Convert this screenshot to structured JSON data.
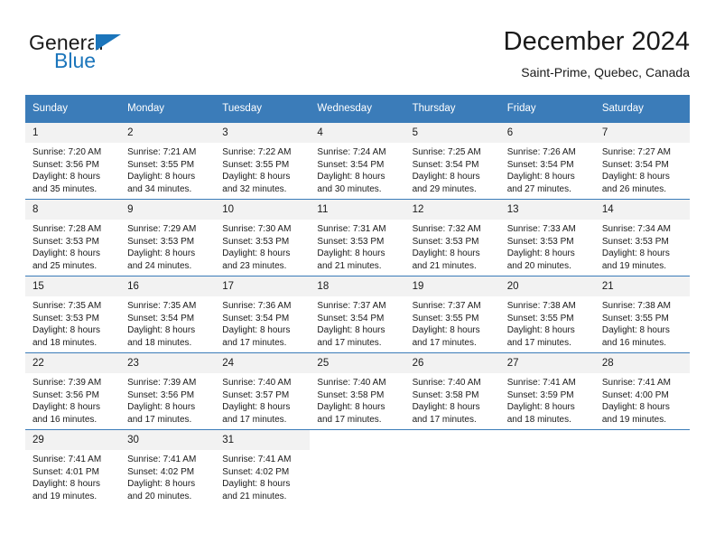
{
  "brand": {
    "word_one": "General",
    "word_two": "Blue",
    "accent_color": "#1b75bb",
    "logo_icon": "triangle-logo-icon"
  },
  "header": {
    "title": "December 2024",
    "subtitle": "Saint-Prime, Quebec, Canada"
  },
  "calendar": {
    "header_bg": "#3b7cb9",
    "daynum_bg": "#f2f2f2",
    "weekdays": [
      "Sunday",
      "Monday",
      "Tuesday",
      "Wednesday",
      "Thursday",
      "Friday",
      "Saturday"
    ],
    "weeks": [
      [
        {
          "day": "1",
          "sunrise": "Sunrise: 7:20 AM",
          "sunset": "Sunset: 3:56 PM",
          "daylight_line1": "Daylight: 8 hours",
          "daylight_line2": "and 35 minutes."
        },
        {
          "day": "2",
          "sunrise": "Sunrise: 7:21 AM",
          "sunset": "Sunset: 3:55 PM",
          "daylight_line1": "Daylight: 8 hours",
          "daylight_line2": "and 34 minutes."
        },
        {
          "day": "3",
          "sunrise": "Sunrise: 7:22 AM",
          "sunset": "Sunset: 3:55 PM",
          "daylight_line1": "Daylight: 8 hours",
          "daylight_line2": "and 32 minutes."
        },
        {
          "day": "4",
          "sunrise": "Sunrise: 7:24 AM",
          "sunset": "Sunset: 3:54 PM",
          "daylight_line1": "Daylight: 8 hours",
          "daylight_line2": "and 30 minutes."
        },
        {
          "day": "5",
          "sunrise": "Sunrise: 7:25 AM",
          "sunset": "Sunset: 3:54 PM",
          "daylight_line1": "Daylight: 8 hours",
          "daylight_line2": "and 29 minutes."
        },
        {
          "day": "6",
          "sunrise": "Sunrise: 7:26 AM",
          "sunset": "Sunset: 3:54 PM",
          "daylight_line1": "Daylight: 8 hours",
          "daylight_line2": "and 27 minutes."
        },
        {
          "day": "7",
          "sunrise": "Sunrise: 7:27 AM",
          "sunset": "Sunset: 3:54 PM",
          "daylight_line1": "Daylight: 8 hours",
          "daylight_line2": "and 26 minutes."
        }
      ],
      [
        {
          "day": "8",
          "sunrise": "Sunrise: 7:28 AM",
          "sunset": "Sunset: 3:53 PM",
          "daylight_line1": "Daylight: 8 hours",
          "daylight_line2": "and 25 minutes."
        },
        {
          "day": "9",
          "sunrise": "Sunrise: 7:29 AM",
          "sunset": "Sunset: 3:53 PM",
          "daylight_line1": "Daylight: 8 hours",
          "daylight_line2": "and 24 minutes."
        },
        {
          "day": "10",
          "sunrise": "Sunrise: 7:30 AM",
          "sunset": "Sunset: 3:53 PM",
          "daylight_line1": "Daylight: 8 hours",
          "daylight_line2": "and 23 minutes."
        },
        {
          "day": "11",
          "sunrise": "Sunrise: 7:31 AM",
          "sunset": "Sunset: 3:53 PM",
          "daylight_line1": "Daylight: 8 hours",
          "daylight_line2": "and 21 minutes."
        },
        {
          "day": "12",
          "sunrise": "Sunrise: 7:32 AM",
          "sunset": "Sunset: 3:53 PM",
          "daylight_line1": "Daylight: 8 hours",
          "daylight_line2": "and 21 minutes."
        },
        {
          "day": "13",
          "sunrise": "Sunrise: 7:33 AM",
          "sunset": "Sunset: 3:53 PM",
          "daylight_line1": "Daylight: 8 hours",
          "daylight_line2": "and 20 minutes."
        },
        {
          "day": "14",
          "sunrise": "Sunrise: 7:34 AM",
          "sunset": "Sunset: 3:53 PM",
          "daylight_line1": "Daylight: 8 hours",
          "daylight_line2": "and 19 minutes."
        }
      ],
      [
        {
          "day": "15",
          "sunrise": "Sunrise: 7:35 AM",
          "sunset": "Sunset: 3:53 PM",
          "daylight_line1": "Daylight: 8 hours",
          "daylight_line2": "and 18 minutes."
        },
        {
          "day": "16",
          "sunrise": "Sunrise: 7:35 AM",
          "sunset": "Sunset: 3:54 PM",
          "daylight_line1": "Daylight: 8 hours",
          "daylight_line2": "and 18 minutes."
        },
        {
          "day": "17",
          "sunrise": "Sunrise: 7:36 AM",
          "sunset": "Sunset: 3:54 PM",
          "daylight_line1": "Daylight: 8 hours",
          "daylight_line2": "and 17 minutes."
        },
        {
          "day": "18",
          "sunrise": "Sunrise: 7:37 AM",
          "sunset": "Sunset: 3:54 PM",
          "daylight_line1": "Daylight: 8 hours",
          "daylight_line2": "and 17 minutes."
        },
        {
          "day": "19",
          "sunrise": "Sunrise: 7:37 AM",
          "sunset": "Sunset: 3:55 PM",
          "daylight_line1": "Daylight: 8 hours",
          "daylight_line2": "and 17 minutes."
        },
        {
          "day": "20",
          "sunrise": "Sunrise: 7:38 AM",
          "sunset": "Sunset: 3:55 PM",
          "daylight_line1": "Daylight: 8 hours",
          "daylight_line2": "and 17 minutes."
        },
        {
          "day": "21",
          "sunrise": "Sunrise: 7:38 AM",
          "sunset": "Sunset: 3:55 PM",
          "daylight_line1": "Daylight: 8 hours",
          "daylight_line2": "and 16 minutes."
        }
      ],
      [
        {
          "day": "22",
          "sunrise": "Sunrise: 7:39 AM",
          "sunset": "Sunset: 3:56 PM",
          "daylight_line1": "Daylight: 8 hours",
          "daylight_line2": "and 16 minutes."
        },
        {
          "day": "23",
          "sunrise": "Sunrise: 7:39 AM",
          "sunset": "Sunset: 3:56 PM",
          "daylight_line1": "Daylight: 8 hours",
          "daylight_line2": "and 17 minutes."
        },
        {
          "day": "24",
          "sunrise": "Sunrise: 7:40 AM",
          "sunset": "Sunset: 3:57 PM",
          "daylight_line1": "Daylight: 8 hours",
          "daylight_line2": "and 17 minutes."
        },
        {
          "day": "25",
          "sunrise": "Sunrise: 7:40 AM",
          "sunset": "Sunset: 3:58 PM",
          "daylight_line1": "Daylight: 8 hours",
          "daylight_line2": "and 17 minutes."
        },
        {
          "day": "26",
          "sunrise": "Sunrise: 7:40 AM",
          "sunset": "Sunset: 3:58 PM",
          "daylight_line1": "Daylight: 8 hours",
          "daylight_line2": "and 17 minutes."
        },
        {
          "day": "27",
          "sunrise": "Sunrise: 7:41 AM",
          "sunset": "Sunset: 3:59 PM",
          "daylight_line1": "Daylight: 8 hours",
          "daylight_line2": "and 18 minutes."
        },
        {
          "day": "28",
          "sunrise": "Sunrise: 7:41 AM",
          "sunset": "Sunset: 4:00 PM",
          "daylight_line1": "Daylight: 8 hours",
          "daylight_line2": "and 19 minutes."
        }
      ],
      [
        {
          "day": "29",
          "sunrise": "Sunrise: 7:41 AM",
          "sunset": "Sunset: 4:01 PM",
          "daylight_line1": "Daylight: 8 hours",
          "daylight_line2": "and 19 minutes."
        },
        {
          "day": "30",
          "sunrise": "Sunrise: 7:41 AM",
          "sunset": "Sunset: 4:02 PM",
          "daylight_line1": "Daylight: 8 hours",
          "daylight_line2": "and 20 minutes."
        },
        {
          "day": "31",
          "sunrise": "Sunrise: 7:41 AM",
          "sunset": "Sunset: 4:02 PM",
          "daylight_line1": "Daylight: 8 hours",
          "daylight_line2": "and 21 minutes."
        },
        {
          "day": "",
          "sunrise": "",
          "sunset": "",
          "daylight_line1": "",
          "daylight_line2": ""
        },
        {
          "day": "",
          "sunrise": "",
          "sunset": "",
          "daylight_line1": "",
          "daylight_line2": ""
        },
        {
          "day": "",
          "sunrise": "",
          "sunset": "",
          "daylight_line1": "",
          "daylight_line2": ""
        },
        {
          "day": "",
          "sunrise": "",
          "sunset": "",
          "daylight_line1": "",
          "daylight_line2": ""
        }
      ]
    ]
  }
}
